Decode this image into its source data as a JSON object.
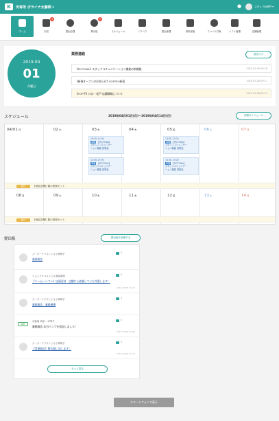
{
  "header": {
    "brand": "天寿所 ポライナ太藤師 ▾",
    "user_name": "スタッフ利伸門 ▾",
    "bell_icon": "bell-icon",
    "logo_icon": "logo-icon"
  },
  "nav": {
    "items": [
      {
        "label": "ホーム",
        "icon": "home-icon",
        "badge": ""
      },
      {
        "label": "お知",
        "icon": "download-icon",
        "badge": "3"
      },
      {
        "label": "提出処理",
        "icon": "chat-icon",
        "badge": ""
      },
      {
        "label": "掲示板",
        "icon": "speech-icon",
        "badge": "2"
      },
      {
        "label": "スケジュール",
        "icon": "calendar-icon",
        "badge": ""
      },
      {
        "label": "ノウハウ",
        "icon": "book-icon",
        "badge": ""
      },
      {
        "label": "提出管理",
        "icon": "mail-icon",
        "badge": ""
      },
      {
        "label": "資料保管",
        "icon": "folder-icon",
        "badge": ""
      },
      {
        "label": "ファイル共有",
        "icon": "cloud-icon",
        "badge": ""
      },
      {
        "label": "シフト管理",
        "icon": "clipboard-icon",
        "badge": ""
      },
      {
        "label": "店舗管理",
        "icon": "people-icon",
        "badge": ""
      }
    ]
  },
  "today": {
    "month": "2019.04",
    "day": "01",
    "weekday": "月曜日"
  },
  "notices": {
    "title": "業務連絡",
    "more_label": "過去ログ",
    "items": [
      {
        "text": "【PICTONA】スタッフコミュニケーション機能の新機能",
        "date": "2019-03-29 09:18"
      },
      {
        "text": "【新規オープンのお知らせ】SORTEO新宿",
        "date": "2019-03-28 09:17"
      },
      {
        "text": "【TOP子】川口・松戸 店舗情報について",
        "date": "2019-03-28 09:14"
      }
    ]
  },
  "schedule": {
    "title": "スケジュール",
    "range": "2019年04月01日(月)～2019年04月14日(日)",
    "button_label": "月間スケジュール",
    "week1": [
      {
        "day": "04/01",
        "w": "月",
        "type": "weekday"
      },
      {
        "day": "02",
        "w": "火",
        "type": "weekday"
      },
      {
        "day": "03",
        "w": "水",
        "type": "weekday"
      },
      {
        "day": "04",
        "w": "木",
        "type": "weekday"
      },
      {
        "day": "05",
        "w": "金",
        "type": "weekday"
      },
      {
        "day": "06",
        "w": "土",
        "type": "sat"
      },
      {
        "day": "07",
        "w": "日",
        "type": "sun"
      }
    ],
    "week2": [
      {
        "day": "08",
        "w": "月",
        "type": "weekday"
      },
      {
        "day": "09",
        "w": "火",
        "type": "weekday"
      },
      {
        "day": "10",
        "w": "水",
        "type": "weekday"
      },
      {
        "day": "11",
        "w": "木",
        "type": "weekday"
      },
      {
        "day": "12",
        "w": "金",
        "type": "weekday"
      },
      {
        "day": "13",
        "w": "土",
        "type": "sat"
      },
      {
        "day": "14",
        "w": "日",
        "type": "sun"
      }
    ],
    "events": [
      {
        "time": "10:30-11:00",
        "tag": "本部",
        "title": "【PICTONA】",
        "desc": "スタッフコミュニケー",
        "sub": "ション機能 説明会"
      },
      {
        "time": "11:00-17:00",
        "tag": "本部",
        "title": "【PICTONA】",
        "desc": "スタッフコミュニケー",
        "sub": "ション機能 説明会"
      },
      {
        "time": "14:30-17:00",
        "tag": "本部",
        "title": "【PICTONA】",
        "desc": "スタッフコミュニケー",
        "sub": "ション機能 説明会"
      },
      {
        "time": "14:30-17:00",
        "tag": "本部",
        "title": "【PICTONA】",
        "desc": "スタッフコミュニケー",
        "sub": "ション機能 説明会"
      }
    ],
    "allday": [
      {
        "tag": "終日",
        "text": "【地区店舗】春の祝祭セット"
      },
      {
        "tag": "終日",
        "text": "【地区店舗】春の祝祭セット"
      }
    ]
  },
  "submissions": {
    "title": "提出板",
    "new_button": "提出板を投稿する",
    "more_button": "もっと見る",
    "items": [
      {
        "kind": "avatar",
        "name": "スーパーテクスト [1] 小林萌子",
        "text": "業務報告",
        "link": true,
        "count": "0",
        "date": ""
      },
      {
        "kind": "avatar",
        "name": "ショップオペスト [2] 越後香理",
        "text": "【ソーヒーシフト】店頭宣材　店舗から依頼していた件案します！",
        "link": true,
        "count": "0",
        "date": "2019-03-28 10:17"
      },
      {
        "kind": "avatar",
        "name": "スーパーテクスト [1] 小林萌子",
        "text": "業務報告　業務連携",
        "link": true,
        "count": "0",
        "date": ""
      },
      {
        "kind": "tag",
        "tag": "本部",
        "name": "お客様 本部 一本寿子",
        "text": "業務報告 本日バンプを追加しました！",
        "link": false,
        "count": "0",
        "date": "2019-03-26 12:00"
      },
      {
        "kind": "avatar",
        "name": "スーパーテクスト [1] 小林萌子",
        "text": "【営業報告】静の展に出します！",
        "link": true,
        "count": "0",
        "date": "2019-03-26 10:17"
      }
    ]
  },
  "footer": {
    "smartphone_button": "スマートフォンで表示"
  },
  "colors": {
    "accent": "#2aa39a",
    "badge": "#e14b3b",
    "event": "#3a83c8",
    "allday": "#e9b84a"
  }
}
